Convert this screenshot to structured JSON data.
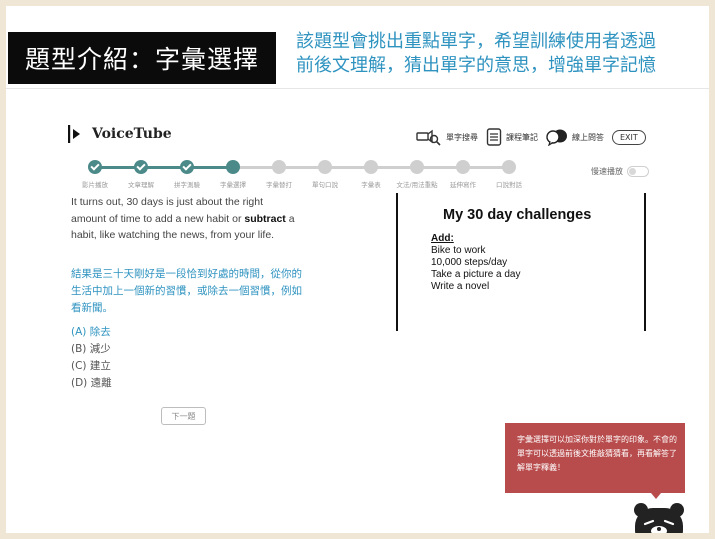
{
  "slide": {
    "title": "題型介紹：字彙選擇",
    "intro_lines": [
      "該題型會挑出重點單字，希望訓練使用者透過",
      "前後文理解，猜出單字的意思，增強單字記憶"
    ]
  },
  "app": {
    "name": "VoiceTube",
    "actions": [
      {
        "label": "單字搜尋",
        "icon": "magnifier-speaker-icon"
      },
      {
        "label": "課程筆記",
        "icon": "notes-icon"
      },
      {
        "label": "線上問答",
        "icon": "chat-bubbles-icon"
      }
    ],
    "exit_label": "EXIT"
  },
  "stepper": {
    "steps": [
      "影片播放",
      "文章理解",
      "拼字測驗",
      "字彙選擇",
      "字彙替打",
      "單句口說",
      "字彙表",
      "文法/用法重點",
      "延伸寫作",
      "口說對話"
    ],
    "completed": 3,
    "current_index": 3
  },
  "autoplay": {
    "label": "慢速播放"
  },
  "question": {
    "passage_pre": "It turns out, 30 days is just about the right amount of time to add a new habit or ",
    "passage_bold": "subtract",
    "passage_post": " a habit, like watching the news, from your life.",
    "translation": "結果是三十天剛好是一段恰到好處的時間，從你的生活中加上一個新的習慣，或除去一個習慣，例如看新聞。",
    "options": [
      "(A) 除去",
      "(B) 減少",
      "(C) 建立",
      "(D) 遠離"
    ],
    "next_label": "下一題"
  },
  "board": {
    "title": "My 30 day challenges",
    "heading": "Add",
    "items": [
      "Bike to work",
      "10,000 steps/day",
      "Take a picture a day",
      "Write a novel"
    ]
  },
  "note": {
    "text": "字彙選擇可以加深你對於單字的印象。不會的單字可以透過前後文推敲猜猜看，再看解答了解單字釋義！"
  },
  "colors": {
    "accent": "#2f93c0",
    "progress": "#4c8a8a",
    "note_bg": "#b84b4c",
    "frame": "#efe6d6"
  }
}
